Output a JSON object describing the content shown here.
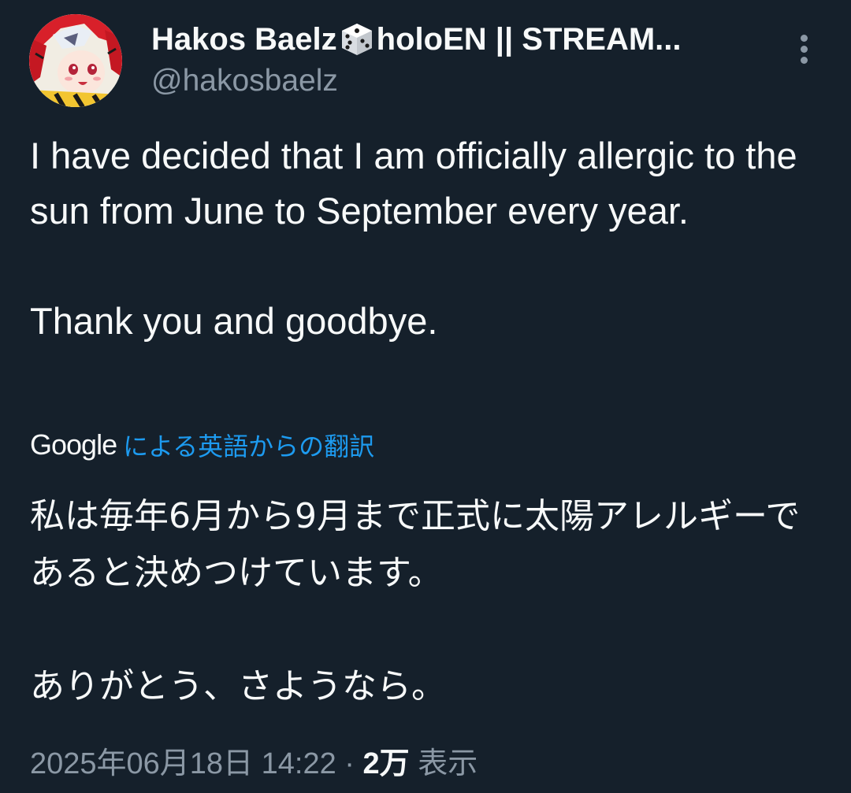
{
  "author": {
    "display_name": "Hakos Baelz",
    "name_suffix": "holoEN || STREAM...",
    "badge_icon": "dice-icon",
    "handle": "@hakosbaelz"
  },
  "tweet": {
    "text_lines": [
      "I have decided that I am officially allergic to the sun from June to September every year.",
      "Thank you and goodbye."
    ],
    "translation": {
      "provider": "Google",
      "link_label": "による英語からの翻訳",
      "text_lines": [
        "私は毎年6月から9月まで正式に太陽アレルギーであると決めつけています。",
        "ありがとう、さようなら。"
      ]
    },
    "timestamp": "2025年06月18日 14:22",
    "separator": "·",
    "views_count": "2万",
    "views_label": "表示"
  },
  "colors": {
    "background": "#15202b",
    "text": "#f7f9f9",
    "secondary": "#8b98a5",
    "link": "#1d9bf0"
  }
}
